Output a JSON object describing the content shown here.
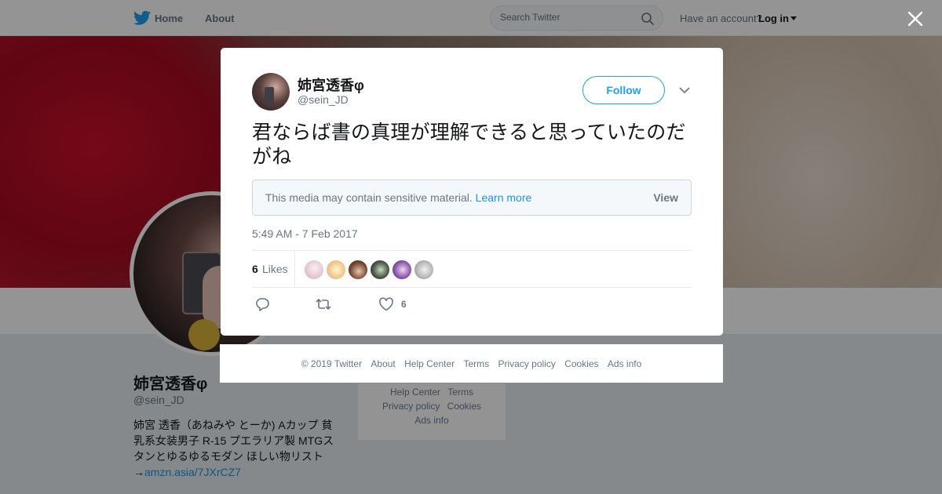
{
  "nav": {
    "home_label": "Home",
    "about_label": "About",
    "search_placeholder": "Search Twitter",
    "account_prompt": "Have an account?",
    "login_label": "Log in"
  },
  "profile": {
    "name": "姉宮透香φ",
    "handle": "@sein_JD",
    "bio_text": "姉宮 透香（あねみや とーか) Aカップ 貧乳系女装男子 R-15 プエラリア製 MTGスタンとゆるゆるモダン ほしい物リスト→",
    "bio_link": "amzn.asia/7JXrCZ7"
  },
  "side_links": [
    "Help Center",
    "Terms",
    "Privacy policy",
    "Cookies",
    "Ads info"
  ],
  "tweet": {
    "author_name": "姉宮透香φ",
    "author_handle": "@sein_JD",
    "follow_label": "Follow",
    "text": "君ならば書の真理が理解できると思っていたのだがね",
    "sensitive_message": "This media may contain sensitive material.",
    "learn_more_label": "Learn more",
    "view_label": "View",
    "timestamp": "5:49 AM - 7 Feb 2017",
    "likes_count": "6",
    "likes_label": "Likes",
    "like_action_count": "6"
  },
  "footer": {
    "copyright": "© 2019 Twitter",
    "links": [
      "About",
      "Help Center",
      "Terms",
      "Privacy policy",
      "Cookies",
      "Ads info"
    ]
  },
  "colors": {
    "accent": "#1da1f2",
    "link": "#1b95e0",
    "text_secondary": "#657786"
  },
  "icons": [
    "twitter-bird-icon",
    "search-icon",
    "close-icon",
    "chevron-down-icon",
    "reply-icon",
    "retweet-icon",
    "heart-icon"
  ]
}
